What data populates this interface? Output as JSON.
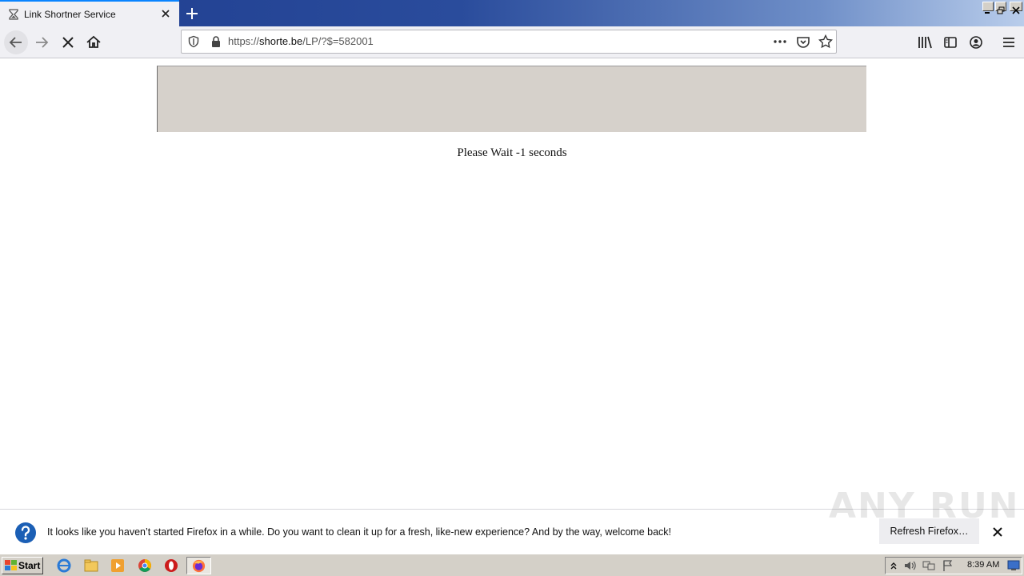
{
  "browser": {
    "tab_title": "Link Shortner Service",
    "url": {
      "prefix": "https://",
      "host": "shorte.be",
      "path": "/LP/?$=582001"
    }
  },
  "page": {
    "wait_text": "Please Wait -1 seconds"
  },
  "notification": {
    "message": "It looks like you haven’t started Firefox in a while. Do you want to clean it up for a fresh, like-new experience? And by the way, welcome back!",
    "button_label": "Refresh Firefox…"
  },
  "watermark": "ANY RUN",
  "taskbar": {
    "start_label": "Start",
    "clock": "8:39 AM"
  },
  "colors": {
    "accent": "#0a84ff",
    "banner": "#d6d1cb",
    "question_icon": "#1b5fb5"
  }
}
